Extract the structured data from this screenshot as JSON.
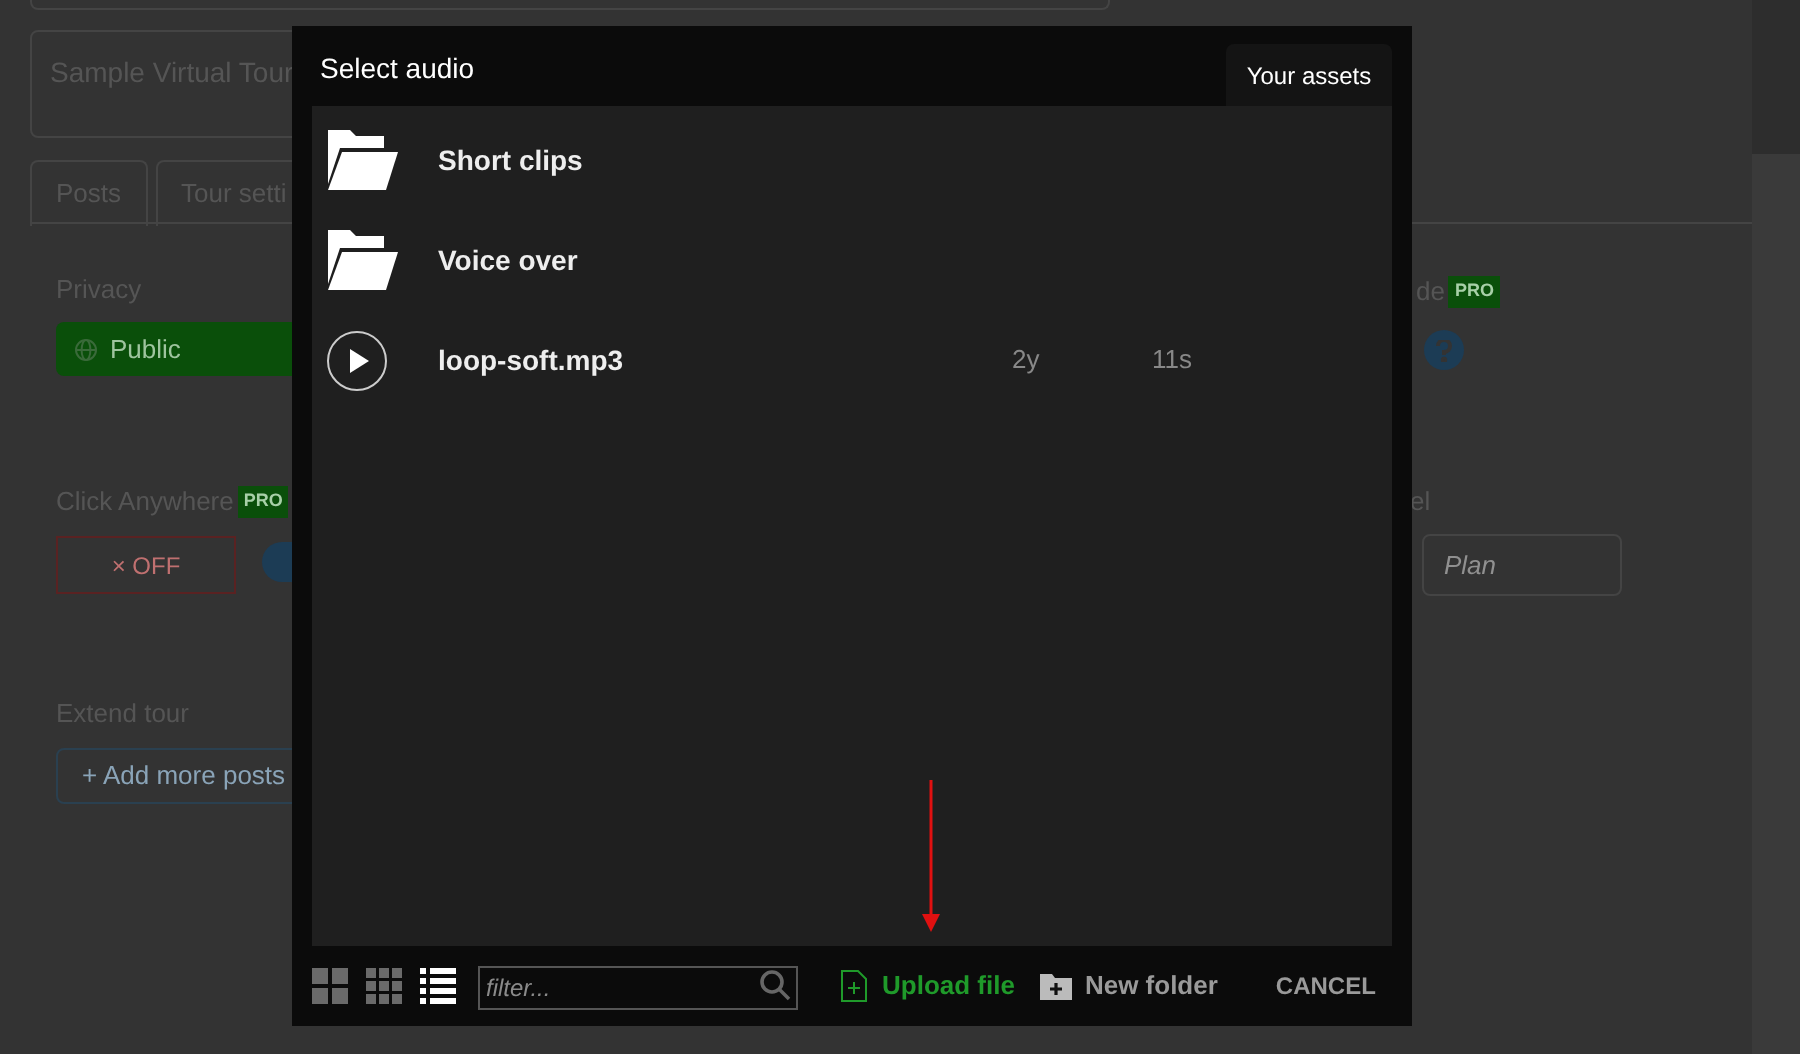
{
  "background_page": {
    "title_field": "Sample Virtual Tour",
    "tabs": [
      "Posts",
      "Tour setti"
    ],
    "privacy": {
      "label": "Privacy",
      "button": "Public"
    },
    "mode": {
      "label": "de",
      "badge": "PRO"
    },
    "click_anywhere": {
      "label": "Click Anywhere",
      "badge": "PRO",
      "toggle": "× OFF"
    },
    "level": {
      "label": "el",
      "placeholder": "Plan"
    },
    "extend_tour": {
      "label": "Extend tour",
      "button": "+ Add more posts"
    }
  },
  "dialog": {
    "title": "Select audio",
    "tab": "Your assets",
    "items": [
      {
        "kind": "folder",
        "name": "Short clips"
      },
      {
        "kind": "folder",
        "name": "Voice over"
      },
      {
        "kind": "audio",
        "name": "loop-soft.mp3",
        "age": "2y",
        "duration": "11s"
      }
    ],
    "views": [
      {
        "kind": "large-grid",
        "selected": false
      },
      {
        "kind": "small-grid",
        "selected": false
      },
      {
        "kind": "list",
        "selected": true
      }
    ],
    "filter": {
      "placeholder": "filter..."
    },
    "upload": "Upload file",
    "new_folder": "New folder",
    "cancel": "CANCEL"
  }
}
